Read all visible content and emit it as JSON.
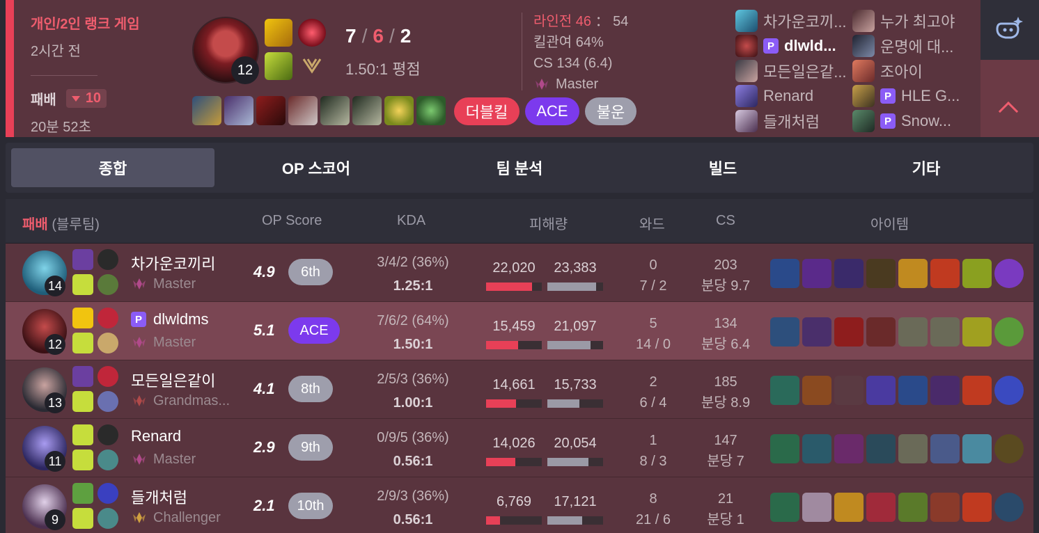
{
  "header": {
    "mode": "개인/2인 랭크 게임",
    "ago": "2시간 전",
    "result": "패배",
    "lp_change": "10",
    "duration": "20분 52초",
    "champion_level": "12",
    "kda": {
      "kills": "7",
      "deaths": "6",
      "assists": "2",
      "sep": "/"
    },
    "kda_ratio": "1.50:1 평점",
    "tags": [
      "더블킬",
      "ACE",
      "불운"
    ],
    "lane": {
      "label": "라인전",
      "ours": "46",
      "sep": "：",
      "theirs": "54"
    },
    "kill_participation": "킬관여 64%",
    "cs": "CS 134 (6.4)",
    "tier": "Master",
    "blue_team": [
      {
        "name": "차가운코끼...",
        "pro": false
      },
      {
        "name": "dlwld...",
        "pro": true,
        "me": true
      },
      {
        "name": "모든일은같...",
        "pro": false
      },
      {
        "name": "Renard",
        "pro": false
      },
      {
        "name": "들개처럼",
        "pro": false
      }
    ],
    "red_team": [
      {
        "name": "누가 최고야",
        "pro": false
      },
      {
        "name": "운명에 대...",
        "pro": false
      },
      {
        "name": "조아이",
        "pro": false
      },
      {
        "name": "HLE G...",
        "pro": true
      },
      {
        "name": "Snow...",
        "pro": true
      }
    ],
    "pro_badge": "P"
  },
  "tabs": [
    "종합",
    "OP 스코어",
    "팀 분석",
    "빌드",
    "기타"
  ],
  "table": {
    "result": "패배",
    "team": "(블루팀)",
    "columns": {
      "op_score": "OP Score",
      "kda": "KDA",
      "damage": "피해량",
      "ward": "와드",
      "cs": "CS",
      "items": "아이템"
    },
    "players": [
      {
        "name": "차가운코끼리",
        "pro": false,
        "level": "14",
        "tier": "Master",
        "score": "4.9",
        "rank": "6th",
        "kda": "3/4/2 (36%)",
        "ratio": "1.25:1",
        "dmg_dealt": "22,020",
        "dmg_taken": "23,383",
        "dealt_pct": 0.82,
        "taken_pct": 0.87,
        "ward": "0",
        "ward_detail": "7 / 2",
        "cs": "203",
        "cs_min": "분당 9.7",
        "me": false
      },
      {
        "name": "dlwldms",
        "pro": true,
        "level": "12",
        "tier": "Master",
        "score": "5.1",
        "rank": "ACE",
        "kda": "7/6/2 (64%)",
        "ratio": "1.50:1",
        "dmg_dealt": "15,459",
        "dmg_taken": "21,097",
        "dealt_pct": 0.57,
        "taken_pct": 0.78,
        "ward": "5",
        "ward_detail": "14 / 0",
        "cs": "134",
        "cs_min": "분당 6.4",
        "me": true
      },
      {
        "name": "모든일은같이",
        "pro": false,
        "level": "13",
        "tier": "Grandmas...",
        "score": "4.1",
        "rank": "8th",
        "kda": "2/5/3 (36%)",
        "ratio": "1.00:1",
        "dmg_dealt": "14,661",
        "dmg_taken": "15,733",
        "dealt_pct": 0.54,
        "taken_pct": 0.58,
        "ward": "2",
        "ward_detail": "6 / 4",
        "cs": "185",
        "cs_min": "분당 8.9",
        "me": false
      },
      {
        "name": "Renard",
        "pro": false,
        "level": "11",
        "tier": "Master",
        "score": "2.9",
        "rank": "9th",
        "kda": "0/9/5 (36%)",
        "ratio": "0.56:1",
        "dmg_dealt": "14,026",
        "dmg_taken": "20,054",
        "dealt_pct": 0.52,
        "taken_pct": 0.74,
        "ward": "1",
        "ward_detail": "8 / 3",
        "cs": "147",
        "cs_min": "분당 7",
        "me": false
      },
      {
        "name": "들개처럼",
        "pro": false,
        "level": "9",
        "tier": "Challenger",
        "score": "2.1",
        "rank": "10th",
        "kda": "2/9/3 (36%)",
        "ratio": "0.56:1",
        "dmg_dealt": "6,769",
        "dmg_taken": "17,121",
        "dealt_pct": 0.25,
        "taken_pct": 0.63,
        "ward": "8",
        "ward_detail": "21 / 6",
        "cs": "21",
        "cs_min": "분당 1",
        "me": false
      }
    ]
  },
  "colors": {
    "loss_red": "#e84057",
    "header_bg": "#59343e",
    "ace_purple": "#7c3aed",
    "pro_purple": "#8b5cf6",
    "dealt_bar": "#e84057",
    "taken_bar": "#9b9aa6"
  },
  "icons": [
    "ai-assistant-icon",
    "chevron-up-icon",
    "lp-down-icon",
    "tier-emblem-icon"
  ]
}
